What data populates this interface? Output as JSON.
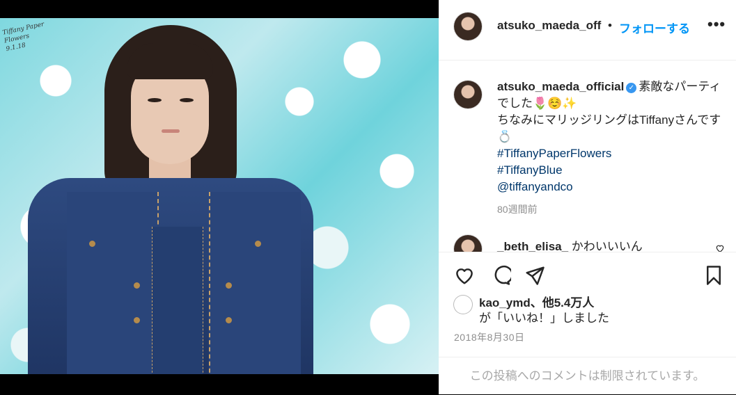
{
  "photo": {
    "sign_line1": "Tiffany Paper Flowers",
    "sign_line2": "9.1.18"
  },
  "header": {
    "username": "atsuko_maeda_off",
    "separator": "•",
    "follow": "フォローする",
    "more": "•••"
  },
  "caption": {
    "username": "atsuko_maeda_official",
    "text_line1": "素敵なパーティでした🌷☺️✨",
    "text_line2": "ちなみにマリッジリングはTiffanyさんです💍",
    "tags": [
      "#TiffanyPaperFlowers",
      "#TiffanyBlue",
      "@tiffanyandco"
    ],
    "time": "80週間前"
  },
  "comment": {
    "username": "_beth_elisa_",
    "text": "かわいいいん"
  },
  "likes": {
    "user": "kao_ymd",
    "count": "、他5.4万人",
    "suffix": "が「いいね！」しました"
  },
  "date": "2018年8月30日",
  "comments_disabled": "この投稿へのコメントは制限されています。"
}
